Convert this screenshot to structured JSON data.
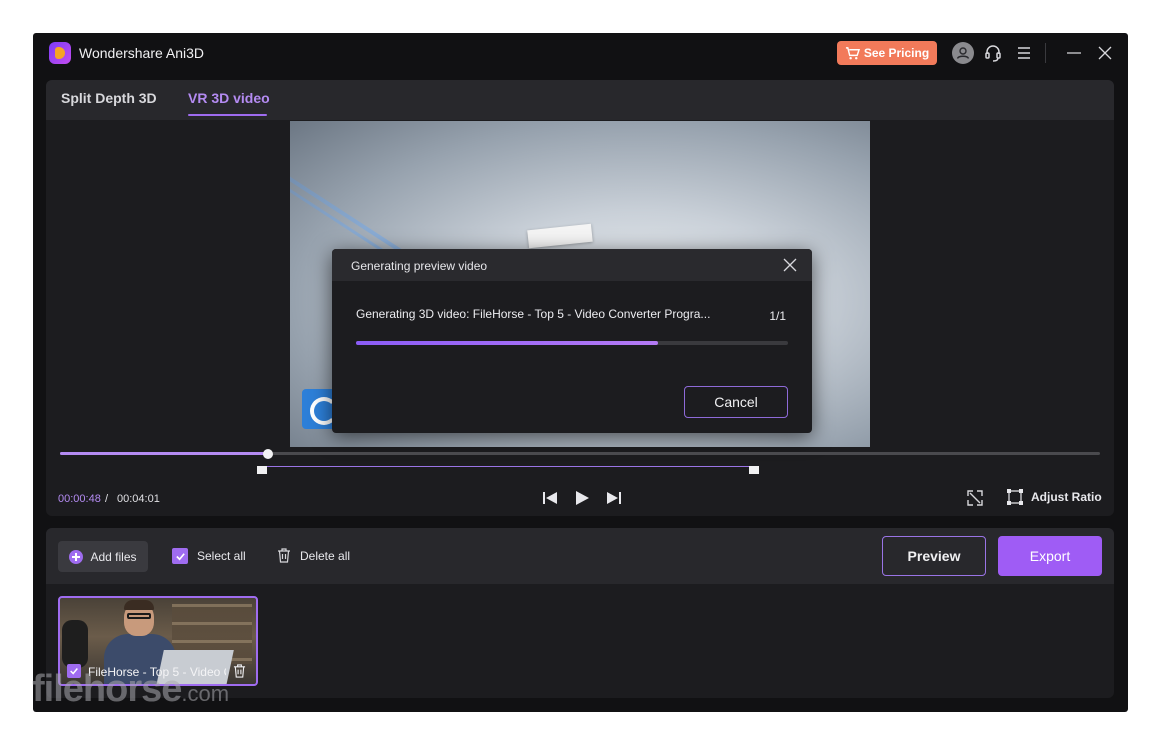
{
  "app": {
    "title": "Wondershare Ani3D",
    "pricing_label": "See Pricing",
    "pricing_color": "#f27a5a"
  },
  "tabs": [
    {
      "label": "Split Depth 3D",
      "active": false
    },
    {
      "label": "VR 3D video",
      "active": true
    }
  ],
  "dialog": {
    "title": "Generating preview video",
    "message": "Generating 3D video: FileHorse - Top 5 - Video Converter Progra...",
    "count": "1/1",
    "progress": 0.7,
    "cancel_label": "Cancel"
  },
  "player": {
    "current_time": "00:00:48",
    "separator": "/",
    "total_time": "00:04:01",
    "playhead_fraction": 0.2,
    "adjust_label": "Adjust Ratio"
  },
  "toolbar": {
    "add_files_label": "Add files",
    "select_all_label": "Select all",
    "delete_all_label": "Delete all",
    "preview_label": "Preview",
    "export_label": "Export"
  },
  "files": [
    {
      "name": "FileHorse - Top 5 - Video C",
      "checked": true
    }
  ],
  "watermark": {
    "text": "filehorse",
    "suffix": ".com"
  },
  "colors": {
    "accent": "#9f6cf0",
    "accent_light": "#b48bf2"
  }
}
